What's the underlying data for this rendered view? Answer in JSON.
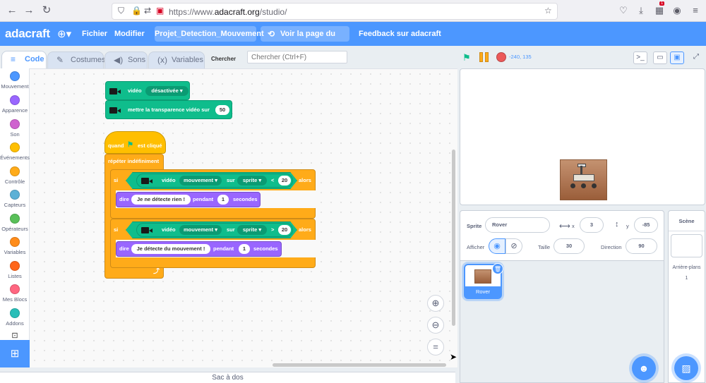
{
  "browser": {
    "url_prefix": "https://www.",
    "url_domain": "adacraft.org",
    "url_path": "/studio/",
    "badge": "1"
  },
  "menubar": {
    "logo": "adacraft",
    "file": "Fichier",
    "edit": "Modifier",
    "project_title": "Projet_Detection_Mouvement",
    "see_project": "Voir la page du projet",
    "feedback": "Feedback sur adacraft"
  },
  "tabs": {
    "code": "Code",
    "costumes": "Costumes",
    "sounds": "Sons",
    "variables": "Variables",
    "search_label": "Chercher",
    "search_placeholder": "Chercher (Ctrl+F)"
  },
  "categories": [
    {
      "label": "Mouvement",
      "color": "#4c97ff"
    },
    {
      "label": "Apparence",
      "color": "#9966ff"
    },
    {
      "label": "Son",
      "color": "#cf63cf"
    },
    {
      "label": "Événements",
      "color": "#ffbf00"
    },
    {
      "label": "Contrôle",
      "color": "#ffab19"
    },
    {
      "label": "Capteurs",
      "color": "#5cb1d6"
    },
    {
      "label": "Opérateurs",
      "color": "#59c059"
    },
    {
      "label": "Variables",
      "color": "#ff8c1a"
    },
    {
      "label": "Listes",
      "color": "#ff661a"
    },
    {
      "label": "Mes Blocs",
      "color": "#ff6680"
    },
    {
      "label": "Addons",
      "color": "#29beb8"
    }
  ],
  "blocks": {
    "video_label": "vidéo",
    "video_state": "désactivée",
    "transparency_label": "mettre la transparence vidéo sur",
    "transparency_value": "50",
    "hat_when": "quand",
    "hat_clicked": "est cliqué",
    "forever": "répéter indéfiniment",
    "if1_si": "si",
    "if1_video": "vidéo",
    "if1_attr": "mouvement",
    "if1_on": "sur",
    "if1_target": "sprite",
    "if1_op": "<",
    "if1_value": "20",
    "if1_then": "alors",
    "say1_label": "dire",
    "say1_text": "Je ne détecte rien !",
    "say1_during": "pendant",
    "say1_secs": "1",
    "say1_unit": "secondes",
    "if2_si": "si",
    "if2_video": "vidéo",
    "if2_attr": "mouvement",
    "if2_on": "sur",
    "if2_target": "sprite",
    "if2_op": ">",
    "if2_value": "20",
    "if2_then": "alors",
    "say2_label": "dire",
    "say2_text": "Je détecte du mouvement !",
    "say2_during": "pendant",
    "say2_secs": "1",
    "say2_unit": "secondes"
  },
  "stage": {
    "coords": "-240, 135"
  },
  "sprite_info": {
    "sprite_label": "Sprite",
    "sprite_name": "Rover",
    "x_label": "x",
    "x_value": "3",
    "y_label": "y",
    "y_value": "-85",
    "show_label": "Afficher",
    "size_label": "Taille",
    "size_value": "30",
    "direction_label": "Direction",
    "direction_value": "90"
  },
  "sprite_list": [
    {
      "name": "Rover"
    }
  ],
  "stage_target": {
    "title": "Scène",
    "backdrops_label": "Arrière-plans",
    "backdrops_count": "1"
  },
  "backpack": "Sac à dos"
}
